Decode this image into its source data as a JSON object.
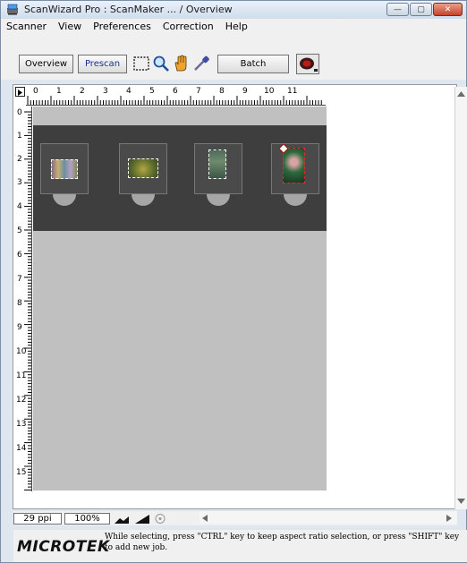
{
  "window": {
    "title": "ScanWizard Pro : ScanMaker ...  / Overview"
  },
  "menu": [
    "Scanner",
    "View",
    "Preferences",
    "Correction",
    "Help"
  ],
  "toolbar": {
    "overview_label": "Overview",
    "prescan_label": "Prescan",
    "batch_label": "Batch"
  },
  "ruler": {
    "h_labels": [
      "0",
      "1",
      "2",
      "3",
      "4",
      "5",
      "6",
      "7",
      "8",
      "9",
      "10",
      "11"
    ],
    "v_labels": [
      "0",
      "1",
      "2",
      "3",
      "4",
      "5",
      "6",
      "7",
      "8",
      "9",
      "10",
      "11",
      "12",
      "13",
      "14",
      "15"
    ]
  },
  "status": {
    "resolution": "29 ppi",
    "zoom": "100%"
  },
  "footer": {
    "logo": "MICROTEK",
    "hint": "While selecting, press \"CTRL\" key to keep aspect ratio selection, or press \"SHIFT\" key to add new job."
  },
  "colors": {
    "strip": "#3e3e3e",
    "preview_bg": "#c0c0c0",
    "close": "#c4432b"
  }
}
